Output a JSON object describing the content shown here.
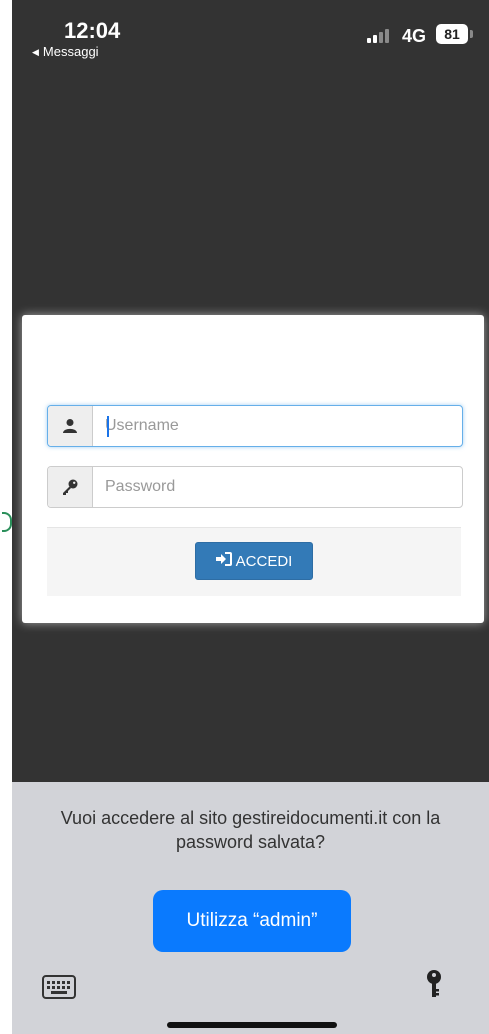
{
  "status_bar": {
    "time": "12:04",
    "back_label": "Messaggi",
    "network": "4G",
    "battery": "81"
  },
  "login": {
    "username_placeholder": "Username",
    "password_placeholder": "Password",
    "submit_label": "ACCEDI",
    "icons": [
      "user-icon",
      "key-icon",
      "sign-in-icon"
    ]
  },
  "password_sheet": {
    "prompt": "Vuoi accedere al sito gestireidocumenti.it con la password salvata?",
    "use_button": "Utilizza “admin”",
    "icons": [
      "keyboard-icon",
      "key-icon"
    ]
  },
  "colors": {
    "overlay": "#333333",
    "accent": "#337ab7",
    "ios_blue": "#0a7afe",
    "sheet": "#d2d3d8"
  }
}
